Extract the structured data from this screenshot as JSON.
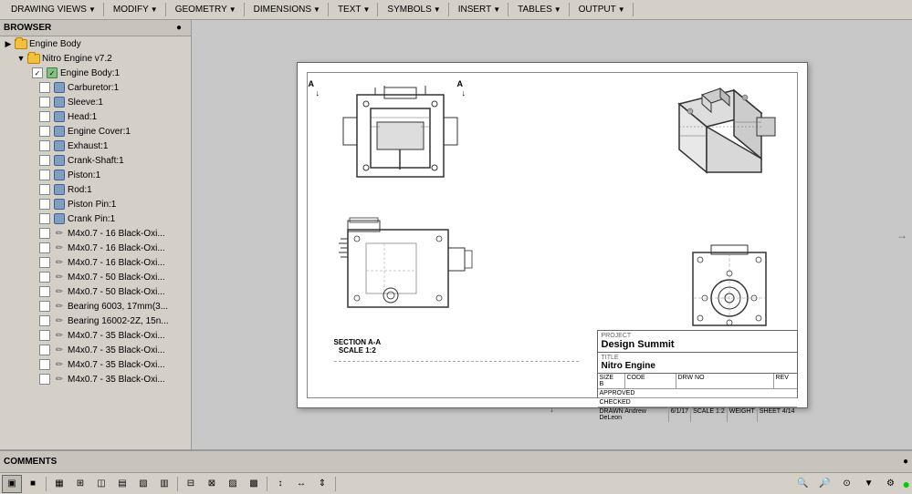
{
  "toolbar": {
    "groups": [
      {
        "label": "DRAWING VIEWS",
        "arrow": "▼"
      },
      {
        "label": "MODIFY",
        "arrow": "▼"
      },
      {
        "label": "GEOMETRY",
        "arrow": "▼"
      },
      {
        "label": "DIMENSIONS",
        "arrow": "▼"
      },
      {
        "label": "TEXT",
        "arrow": "▼"
      },
      {
        "label": "SYMBOLS",
        "arrow": "▼"
      },
      {
        "label": "INSERT",
        "arrow": "▼"
      },
      {
        "label": "TABLES",
        "arrow": "▼"
      },
      {
        "label": "OUTPUT",
        "arrow": "▼"
      }
    ]
  },
  "browser": {
    "title": "BROWSER",
    "pin_label": "●",
    "tree": {
      "root": "Engine Body",
      "child1": "Nitro Engine v7.2",
      "items": [
        {
          "id": 1,
          "label": "Engine Body:1",
          "indent": 3,
          "has_expand": true,
          "checked": true,
          "has_icon": "check"
        },
        {
          "id": 2,
          "label": "Carburetor:1",
          "indent": 4,
          "checked": false,
          "has_icon": "part"
        },
        {
          "id": 3,
          "label": "Sleeve:1",
          "indent": 4,
          "checked": false,
          "has_icon": "part"
        },
        {
          "id": 4,
          "label": "Head:1",
          "indent": 4,
          "checked": false,
          "has_icon": "part"
        },
        {
          "id": 5,
          "label": "Engine Cover:1",
          "indent": 4,
          "checked": false,
          "has_icon": "part"
        },
        {
          "id": 6,
          "label": "Exhaust:1",
          "indent": 4,
          "checked": false,
          "has_icon": "part"
        },
        {
          "id": 7,
          "label": "Crank-Shaft:1",
          "indent": 4,
          "checked": false,
          "has_icon": "part"
        },
        {
          "id": 8,
          "label": "Piston:1",
          "indent": 4,
          "checked": false,
          "has_icon": "part"
        },
        {
          "id": 9,
          "label": "Rod:1",
          "indent": 4,
          "checked": false,
          "has_icon": "part"
        },
        {
          "id": 10,
          "label": "Piston Pin:1",
          "indent": 4,
          "checked": false,
          "has_icon": "part"
        },
        {
          "id": 11,
          "label": "Crank Pin:1",
          "indent": 4,
          "checked": false,
          "has_icon": "part"
        },
        {
          "id": 12,
          "label": "M4x0.7 - 16 Black-Oxi...",
          "indent": 4,
          "checked": false,
          "has_icon": "pencil"
        },
        {
          "id": 13,
          "label": "M4x0.7 - 16 Black-Oxi...",
          "indent": 4,
          "checked": false,
          "has_icon": "pencil"
        },
        {
          "id": 14,
          "label": "M4x0.7 - 16 Black-Oxi...",
          "indent": 4,
          "checked": false,
          "has_icon": "pencil"
        },
        {
          "id": 15,
          "label": "M4x0.7 - 50 Black-Oxi...",
          "indent": 4,
          "checked": false,
          "has_icon": "pencil"
        },
        {
          "id": 16,
          "label": "M4x0.7 - 50 Black-Oxi...",
          "indent": 4,
          "checked": false,
          "has_icon": "pencil"
        },
        {
          "id": 17,
          "label": "Bearing 6003, 17mm(3...",
          "indent": 4,
          "checked": false,
          "has_icon": "pencil"
        },
        {
          "id": 18,
          "label": "Bearing 16002-2Z, 15n...",
          "indent": 4,
          "checked": false,
          "has_icon": "pencil"
        },
        {
          "id": 19,
          "label": "M4x0.7 - 35 Black-Oxi...",
          "indent": 4,
          "checked": false,
          "has_icon": "pencil"
        },
        {
          "id": 20,
          "label": "M4x0.7 - 35 Black-Oxi...",
          "indent": 4,
          "checked": false,
          "has_icon": "pencil"
        },
        {
          "id": 21,
          "label": "M4x0.7 - 35 Black-Oxi...",
          "indent": 4,
          "checked": false,
          "has_icon": "pencil"
        },
        {
          "id": 22,
          "label": "M4x0.7 - 35 Black-Oxi...",
          "indent": 4,
          "checked": false,
          "has_icon": "pencil"
        }
      ]
    }
  },
  "drawing": {
    "section_label": "SECTION A-A",
    "scale_label": "SCALE 1:2",
    "section_a_markers": [
      "A",
      "A"
    ],
    "arrows": [
      "←",
      "→",
      "↑",
      "↓"
    ]
  },
  "title_block": {
    "project_label": "PROJECT",
    "project_name": "Design Summit",
    "title_label": "TITLE",
    "title_name": "Nitro Engine",
    "size_label": "SIZE",
    "size_value": "B",
    "code_label": "CODE",
    "drw_no_label": "DRW NO",
    "rev_label": "REV",
    "approved_label": "APPROVED",
    "checked_label": "CHECKED",
    "drawn_label": "DRAWN",
    "drawn_by": "Andrew DeLeon",
    "date_value": "6/1/17",
    "scale_value": "SCALE 1:2",
    "weight_label": "WEIGHT",
    "sheet_label": "SHEET 4/14"
  },
  "comments": {
    "title": "COMMENTS",
    "pin_label": "●"
  },
  "bottom_toolbar": {
    "buttons": [
      "■",
      "□",
      "▦",
      "▤",
      "◫",
      "▥",
      "▣",
      "▧",
      "▨",
      "▩",
      "⊞",
      "⊟",
      "⊠",
      "⊡",
      "↕",
      "↔",
      "⇕"
    ],
    "zoom_in": "+",
    "zoom_out": "-",
    "zoom_fit": "⊙",
    "view_options": "▼"
  },
  "statusbar": {
    "zoom_in": "🔍+",
    "zoom_out": "🔍-",
    "zoom_fit": "🔍",
    "indicator": "●"
  }
}
